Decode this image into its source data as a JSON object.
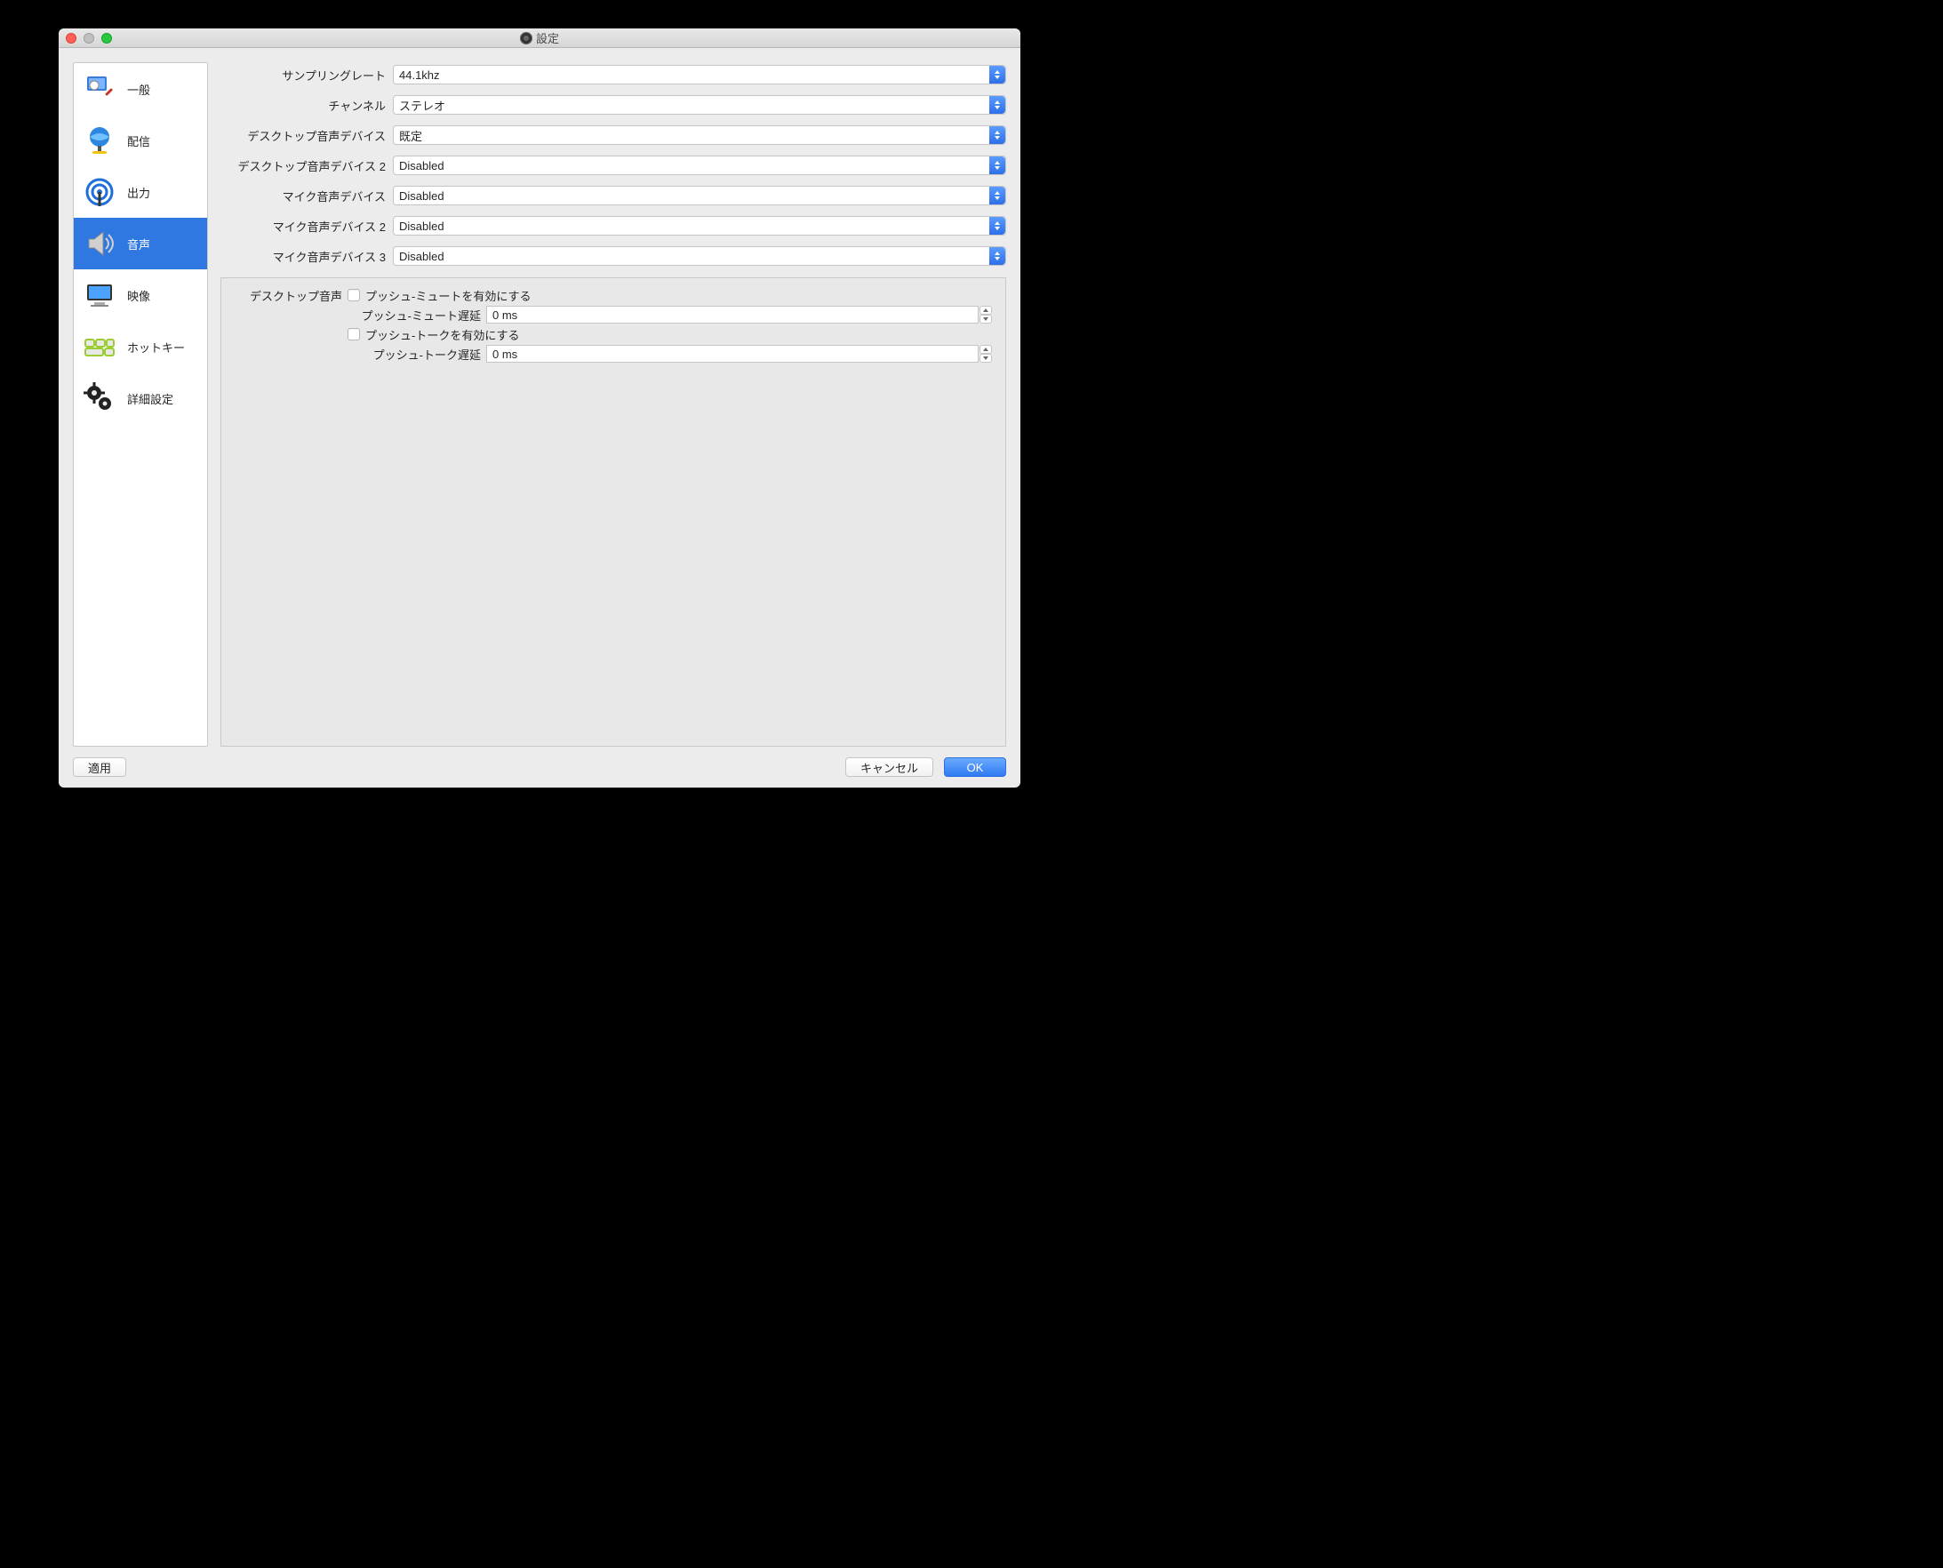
{
  "window": {
    "title": "設定"
  },
  "sidebar": {
    "items": [
      {
        "label": "一般"
      },
      {
        "label": "配信"
      },
      {
        "label": "出力"
      },
      {
        "label": "音声"
      },
      {
        "label": "映像"
      },
      {
        "label": "ホットキー"
      },
      {
        "label": "詳細設定"
      }
    ]
  },
  "form": {
    "sample_rate": {
      "label": "サンプリングレート",
      "value": "44.1khz"
    },
    "channels": {
      "label": "チャンネル",
      "value": "ステレオ"
    },
    "desk1": {
      "label": "デスクトップ音声デバイス",
      "value": "既定"
    },
    "desk2": {
      "label": "デスクトップ音声デバイス 2",
      "value": "Disabled"
    },
    "mic1": {
      "label": "マイク音声デバイス",
      "value": "Disabled"
    },
    "mic2": {
      "label": "マイク音声デバイス 2",
      "value": "Disabled"
    },
    "mic3": {
      "label": "マイク音声デバイス 3",
      "value": "Disabled"
    }
  },
  "group": {
    "title": "デスクトップ音声",
    "push_mute_enable": "プッシュ-ミュートを有効にする",
    "push_mute_delay_label": "プッシュ-ミュート遅延",
    "push_mute_delay_value": "0 ms",
    "push_talk_enable": "プッシュ-トークを有効にする",
    "push_talk_delay_label": "プッシュ-トーク遅延",
    "push_talk_delay_value": "0 ms"
  },
  "footer": {
    "apply": "適用",
    "cancel": "キャンセル",
    "ok": "OK"
  }
}
